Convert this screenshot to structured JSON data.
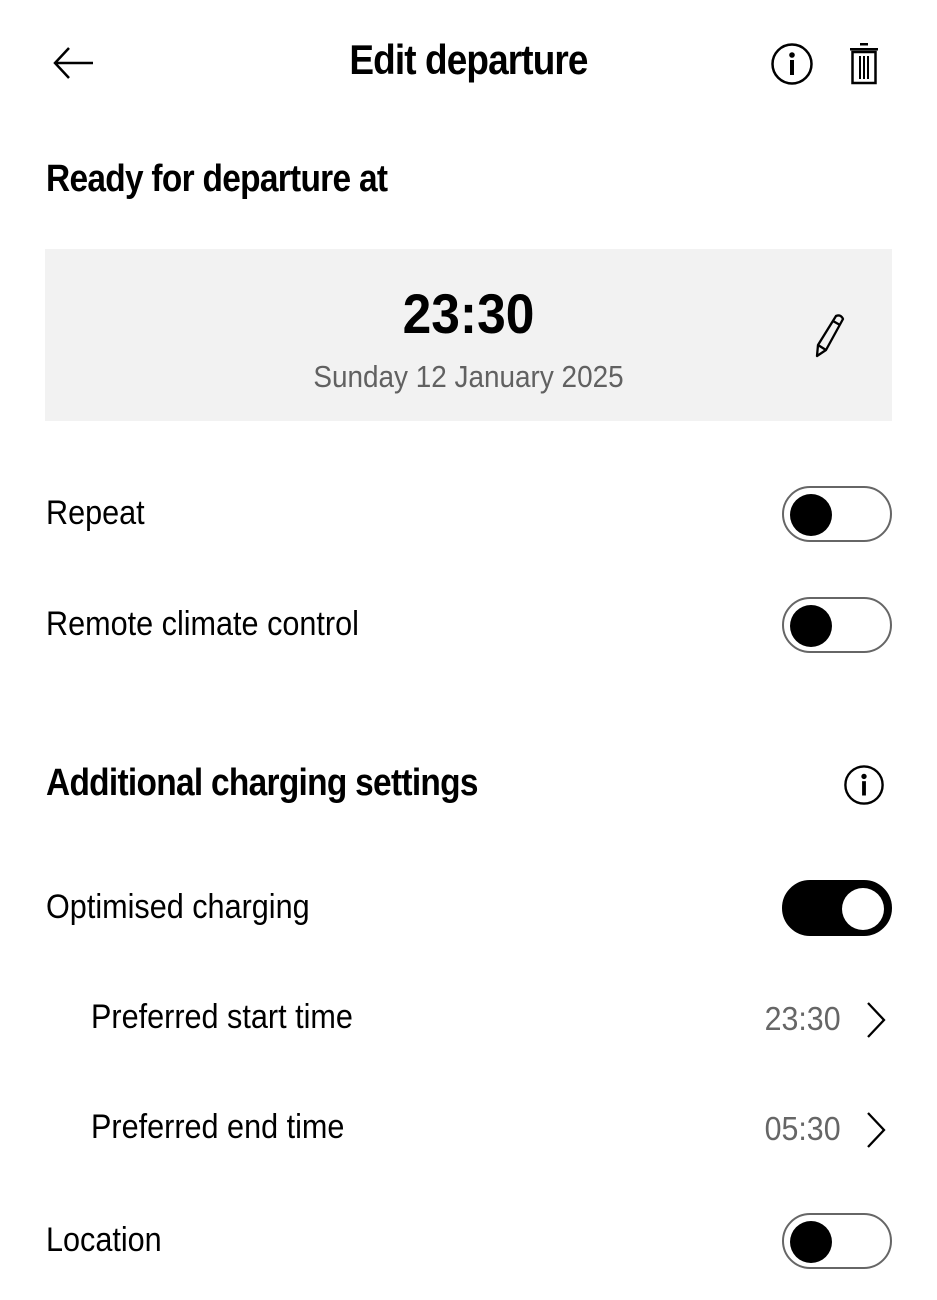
{
  "header": {
    "title": "Edit departure",
    "back_icon": "arrow-left-icon",
    "info_icon": "info-icon",
    "delete_icon": "trash-icon"
  },
  "departure": {
    "section_title": "Ready for departure at",
    "time": "23:30",
    "date": "Sunday 12 January 2025",
    "edit_icon": "pencil-icon"
  },
  "settings": {
    "repeat": {
      "label": "Repeat",
      "enabled": false
    },
    "remote_climate": {
      "label": "Remote climate control",
      "enabled": false
    }
  },
  "charging": {
    "section_title": "Additional charging settings",
    "info_icon": "info-icon",
    "optimised": {
      "label": "Optimised charging",
      "enabled": true
    },
    "start_time": {
      "label": "Preferred start time",
      "value": "23:30"
    },
    "end_time": {
      "label": "Preferred end time",
      "value": "05:30"
    },
    "location": {
      "label": "Location",
      "enabled": false
    }
  },
  "colors": {
    "card_bg": "#f2f2f2",
    "secondary_text": "#666666",
    "toggle_on": "#000000"
  }
}
